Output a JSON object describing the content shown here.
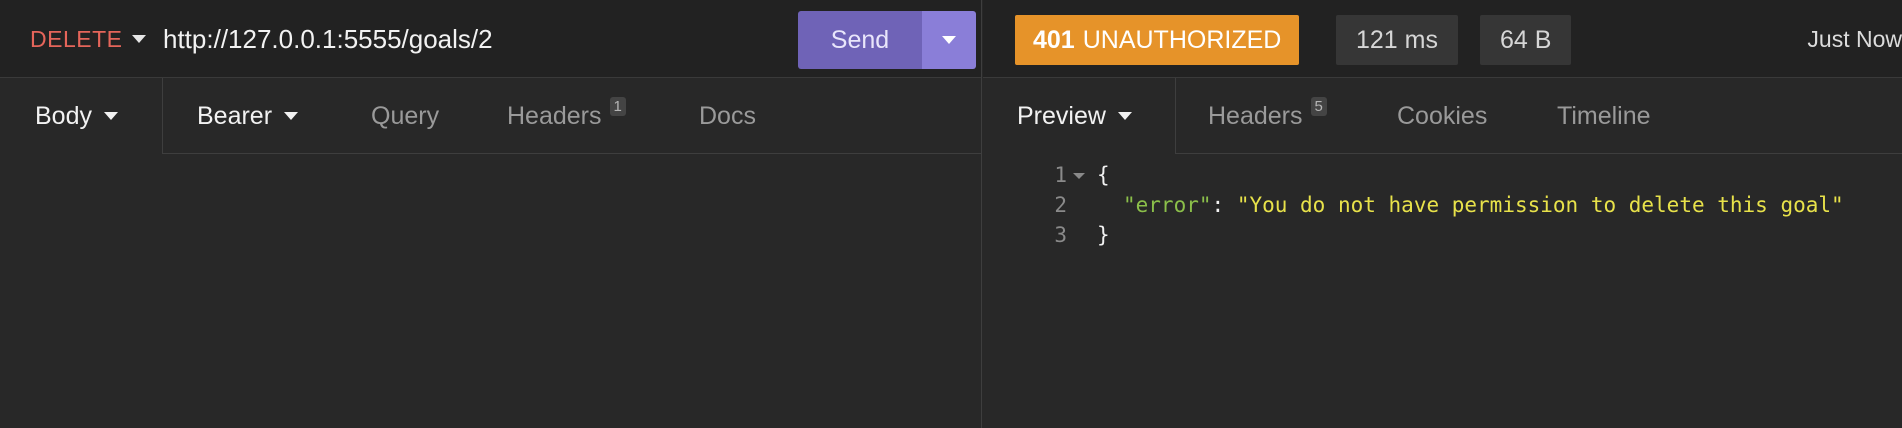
{
  "request": {
    "method": "DELETE",
    "url": "http://127.0.0.1:5555/goals/2",
    "send_label": "Send",
    "tabs": [
      {
        "label": "Body"
      },
      {
        "label": "Bearer"
      },
      {
        "label": "Query"
      },
      {
        "label": "Headers",
        "badge": "1"
      },
      {
        "label": "Docs"
      }
    ]
  },
  "response": {
    "status_code": "401",
    "status_text": "UNAUTHORIZED",
    "time": "121 ms",
    "size": "64 B",
    "timestamp": "Just Now",
    "tabs": [
      {
        "label": "Preview"
      },
      {
        "label": "Headers",
        "badge": "5"
      },
      {
        "label": "Cookies"
      },
      {
        "label": "Timeline"
      }
    ],
    "body": {
      "line_numbers": [
        "1",
        "2",
        "3"
      ],
      "open_brace": "{",
      "key": "\"error\"",
      "colon": ": ",
      "value": "\"You do not have permission to delete this goal\"",
      "close_brace": "}"
    }
  },
  "colors": {
    "method_delete": "#e5655a",
    "send_button": "#6f63b7",
    "status_401": "#e69329",
    "json_key": "#8bbf4a",
    "json_string": "#e8e24a"
  }
}
